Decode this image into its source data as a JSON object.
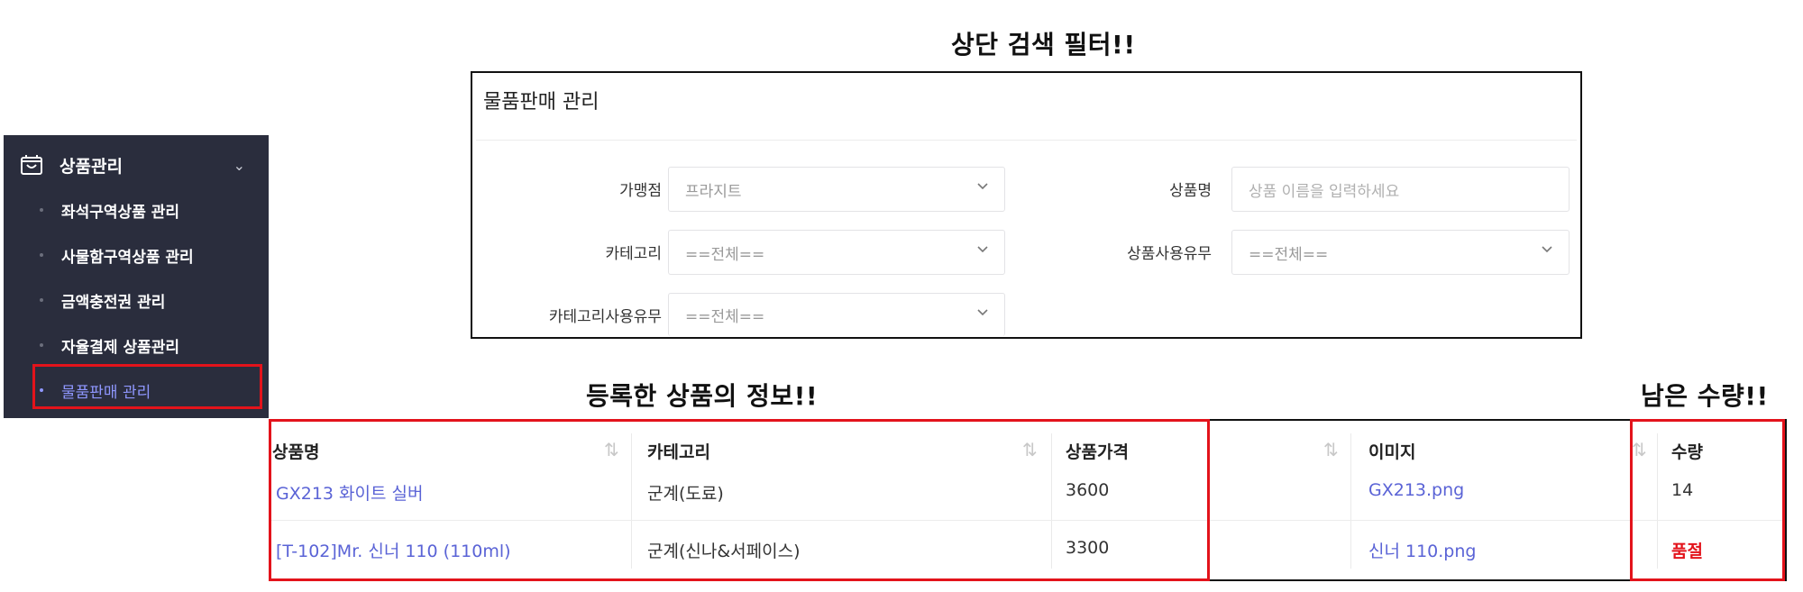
{
  "annotations": {
    "filter": "상단 검색 필터!!",
    "info": "등록한 상품의 정보!!",
    "qty": "남은 수량!!"
  },
  "sidebar": {
    "header": {
      "icon": "box-icon",
      "label": "상품관리",
      "chevron": "chevron-down-icon"
    },
    "items": [
      {
        "label": "좌석구역상품 관리"
      },
      {
        "label": "사물함구역상품 관리"
      },
      {
        "label": "금액충전권 관리"
      },
      {
        "label": "자율결제 상품관리"
      },
      {
        "label": "물품판매 관리",
        "active": true
      }
    ],
    "active_color": "#8f97ff"
  },
  "filter_panel": {
    "title": "물품판매 관리",
    "fields": {
      "franchise": {
        "label": "가맹점",
        "value": "프라지트"
      },
      "product_name": {
        "label": "상품명",
        "placeholder": "상품 이름을 입력하세요"
      },
      "category": {
        "label": "카테고리",
        "value": "==전체=="
      },
      "product_use": {
        "label": "상품사용유무",
        "value": "==전체=="
      },
      "category_use": {
        "label": "카테고리사용유무",
        "value": "==전체=="
      }
    }
  },
  "table": {
    "columns": [
      "상품명",
      "카테고리",
      "상품가격",
      "이미지",
      "수량"
    ],
    "rows": [
      {
        "name": "GX213 화이트 실버",
        "category": "군계(도료)",
        "price": "3600",
        "image": "GX213.png",
        "qty": "14"
      },
      {
        "name": "[T-102]Mr. 신너 110 (110ml)",
        "category": "군계(신나&서페이스)",
        "price": "3300",
        "image": "신너 110.png",
        "qty": "품절"
      }
    ]
  },
  "colors": {
    "highlight_red": "#e3131b",
    "link": "#5a63d6",
    "sidebar_bg": "#2a2d3d"
  }
}
